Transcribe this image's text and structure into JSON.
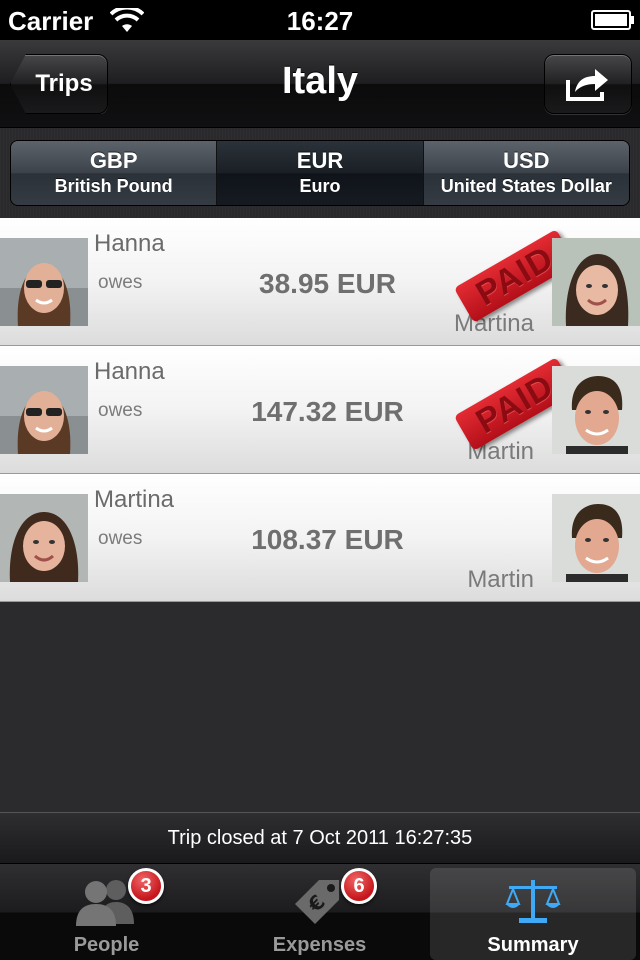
{
  "status_bar": {
    "carrier": "Carrier",
    "time": "16:27",
    "wifi_icon": "wifi-icon",
    "battery_icon": "battery-icon"
  },
  "nav": {
    "back_label": "Trips",
    "title": "Italy",
    "share_icon": "share-icon"
  },
  "currencies": [
    {
      "code": "GBP",
      "name": "British Pound",
      "selected": false
    },
    {
      "code": "EUR",
      "name": "Euro",
      "selected": true
    },
    {
      "code": "USD",
      "name": "United States Dollar",
      "selected": false
    }
  ],
  "debts": [
    {
      "debtor": "Hanna",
      "owes_label": "owes",
      "amount": "38.95 EUR",
      "creditor": "Martina",
      "paid": true,
      "paid_label": "PAID"
    },
    {
      "debtor": "Hanna",
      "owes_label": "owes",
      "amount": "147.32 EUR",
      "creditor": "Martin",
      "paid": true,
      "paid_label": "PAID"
    },
    {
      "debtor": "Martina",
      "owes_label": "owes",
      "amount": "108.37 EUR",
      "creditor": "Martin",
      "paid": false
    }
  ],
  "footer": {
    "status_text": "Trip closed at 7 Oct 2011 16:27:35"
  },
  "tabs": [
    {
      "label": "People",
      "badge": "3",
      "icon": "people-icon",
      "selected": false
    },
    {
      "label": "Expenses",
      "badge": "6",
      "icon": "price-tag-icon",
      "selected": false
    },
    {
      "label": "Summary",
      "icon": "scales-icon",
      "selected": true
    }
  ],
  "colors": {
    "accent_blue": "#3fa9f5",
    "badge_red": "#c4161c",
    "paid_red": "#d0202a"
  }
}
